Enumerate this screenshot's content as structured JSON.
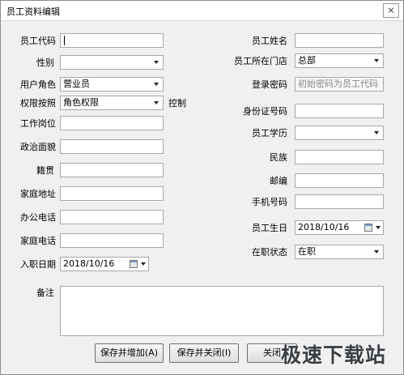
{
  "window": {
    "title": "员工资料编辑",
    "close_glyph": "×"
  },
  "form": {
    "employee_code": {
      "label": "员工代码",
      "value": ""
    },
    "employee_name": {
      "label": "员工姓名",
      "value": ""
    },
    "gender": {
      "label": "性别",
      "value": ""
    },
    "store": {
      "label": "员工所在门店",
      "value": "总部"
    },
    "user_role": {
      "label": "用户角色",
      "value": "营业员"
    },
    "login_password": {
      "label": "登录密码",
      "placeholder": "初始密码为员工代码"
    },
    "permission_by": {
      "label": "权限按照",
      "value": "角色权限",
      "suffix": "控制"
    },
    "id_number": {
      "label": "身份证号码",
      "value": ""
    },
    "job_position": {
      "label": "工作岗位",
      "value": ""
    },
    "education": {
      "label": "员工学历",
      "value": ""
    },
    "political_status": {
      "label": "政治面貌",
      "value": ""
    },
    "ethnicity": {
      "label": "民族",
      "value": ""
    },
    "native_place": {
      "label": "籍贯",
      "value": ""
    },
    "postcode": {
      "label": "邮编",
      "value": ""
    },
    "home_address": {
      "label": "家庭地址",
      "value": ""
    },
    "mobile": {
      "label": "手机号码",
      "value": ""
    },
    "office_phone": {
      "label": "办公电话",
      "value": ""
    },
    "birthday": {
      "label": "员工生日",
      "value": "2018/10/16"
    },
    "home_phone": {
      "label": "家庭电话",
      "value": ""
    },
    "status": {
      "label": "在职状态",
      "value": "在职"
    },
    "hire_date": {
      "label": "入职日期",
      "value": "2018/10/16"
    },
    "remarks": {
      "label": "备注",
      "value": ""
    }
  },
  "buttons": {
    "save_add": "保存并增加(A)",
    "save_close": "保存并关闭(I)",
    "close": "关闭"
  },
  "watermark": "极速下载站"
}
